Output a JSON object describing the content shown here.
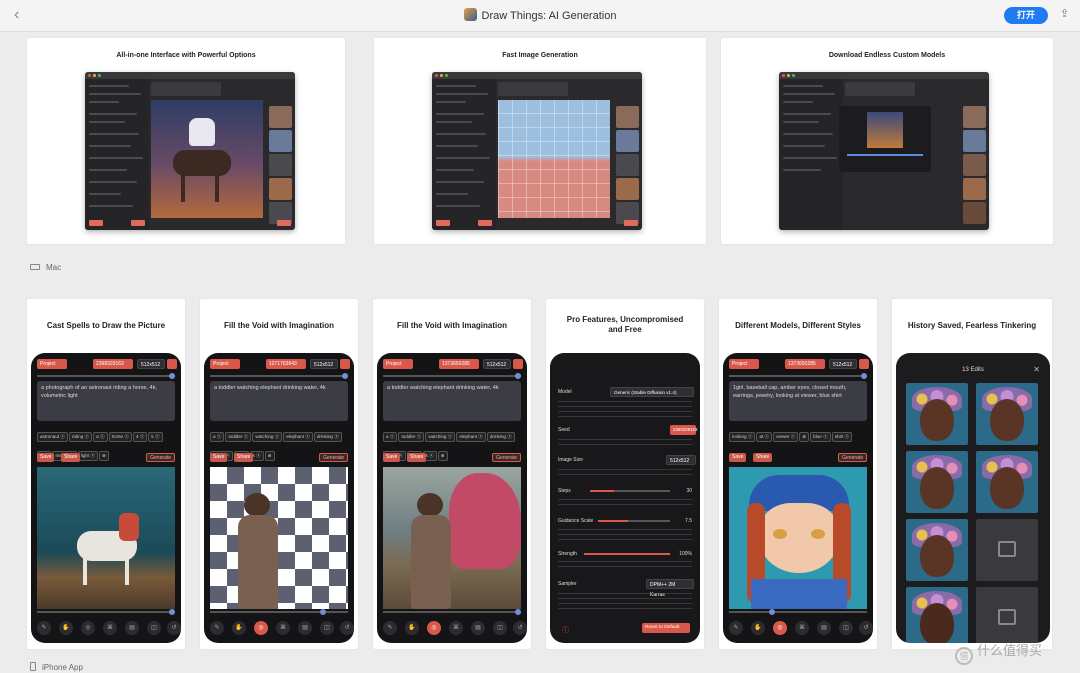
{
  "window": {
    "title": "Draw Things: AI Generation",
    "open_label": "打开",
    "back_glyph": "‹",
    "share_glyph": "⇪"
  },
  "mac_section": {
    "label": "Mac",
    "cards": [
      {
        "title": "All-in-one Interface with  Powerful Options"
      },
      {
        "title": "Fast Image Generation"
      },
      {
        "title": "Download Endless Custom Models"
      }
    ]
  },
  "iphone_section": {
    "label": "iPhone App",
    "cards": [
      {
        "title": "Cast Spells to Draw the Picture",
        "project": "Project",
        "seed": "2398329163",
        "size": "512x512",
        "prompt": "a photograph of an astronaut riding a horse, 4k, volumetric light",
        "tags": [
          "astronaut ⓧ",
          "riding ⓧ",
          "a ⓧ",
          "horse ⓧ",
          "4 ⓧ",
          "k ⓧ",
          "volu",
          "metric ⓧ",
          "light ⓧ",
          "⊕"
        ]
      },
      {
        "title": "Fill the Void with Imagination",
        "project": "Project",
        "seed": "1271763643",
        "size": "512x512",
        "prompt": "a toddler watching elephant drinking water, 4k",
        "tags": [
          "a ⓧ",
          "toddler ⓧ",
          "watching ⓧ",
          "elephant ⓧ",
          "drinking ⓧ",
          "water ⓧ",
          "4 ⓧ",
          "k ⓧ",
          "⊕"
        ]
      },
      {
        "title": "Fill the Void with Imagination",
        "project": "Project",
        "seed": "1373650285",
        "size": "512x512",
        "prompt": "a toddler watching elephant drinking water, 4k",
        "tags": [
          "a ⓧ",
          "toddler ⓧ",
          "watching ⓧ",
          "elephant ⓧ",
          "drinking ⓧ",
          "water ⓧ",
          "4 ⓧ",
          "k ⓧ",
          "⊕"
        ]
      },
      {
        "title": "Pro Features, Uncompromised and Free",
        "model_label": "Model",
        "model_value": "Generic (Stable Diffusion v1.4)",
        "seed_label": "Seed",
        "seed_value": "2398329163",
        "size_label": "Image Size",
        "size_value": "512x512",
        "steps_label": "Steps",
        "steps_value": "30",
        "guidance_label": "Guidance Scale",
        "guidance_value": "7.5",
        "strength_label": "Strength",
        "strength_value": "100%",
        "sampler_label": "Sampler",
        "sampler_value": "DPM++ 2M Karras",
        "reset_label": "Reset to Default"
      },
      {
        "title": "Different Models, Different Styles",
        "project": "Project",
        "seed": "1373650285",
        "size": "512x512",
        "prompt": "1girl, baseball cap, amber eyes, closed mouth, earrings, jewelry, looking at viewer, blue shirt",
        "tags": [
          "looking ⓧ",
          "at ⓧ",
          "viewer ⓧ",
          "⊕",
          "blue ⓧ",
          "shirt ⓧ"
        ]
      },
      {
        "title": "History Saved, Fearless Tinkering",
        "edits_label": "13 Edits"
      }
    ],
    "buttons": {
      "save": "Save",
      "share": "Share",
      "generate": "Generate"
    }
  },
  "watermark": "什么值得买",
  "colors": {
    "accent": "#d9584a",
    "open_blue": "#1f7bf2"
  }
}
